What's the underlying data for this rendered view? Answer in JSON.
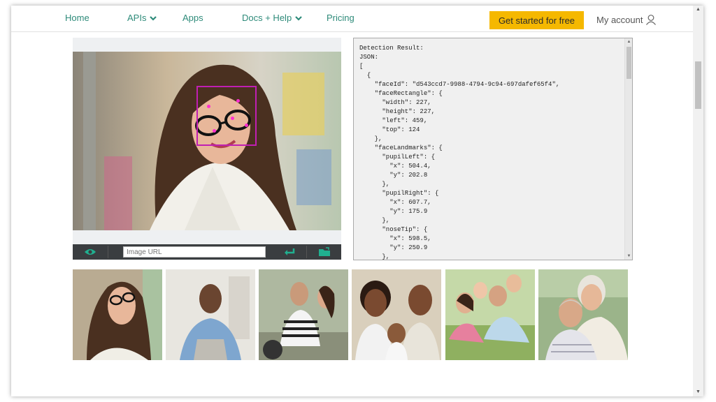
{
  "nav": {
    "home": "Home",
    "apis": "APIs",
    "apps": "Apps",
    "docs": "Docs + Help",
    "pricing": "Pricing",
    "cta": "Get started for free",
    "account": "My account"
  },
  "image_url": {
    "placeholder": "Image URL"
  },
  "json_output": "Detection Result:\nJSON:\n[\n  {\n    \"faceId\": \"d543ccd7-9988-4794-9c94-697dafef65f4\",\n    \"faceRectangle\": {\n      \"width\": 227,\n      \"height\": 227,\n      \"left\": 459,\n      \"top\": 124\n    },\n    \"faceLandmarks\": {\n      \"pupilLeft\": {\n        \"x\": 504.4,\n        \"y\": 202.8\n      },\n      \"pupilRight\": {\n        \"x\": 607.7,\n        \"y\": 175.9\n      },\n      \"noseTip\": {\n        \"x\": 598.5,\n        \"y\": 250.9\n      },",
  "colors": {
    "accent": "#2e8b7a",
    "cta": "#f5b800",
    "face_box": "#c01fb3",
    "toolbar": "#3a3d40",
    "toolbar_icon": "#20b090"
  },
  "thumbnails": [
    {
      "name": "woman-with-glasses"
    },
    {
      "name": "man-denim-shirt"
    },
    {
      "name": "couple-on-scooter"
    },
    {
      "name": "family-with-baby"
    },
    {
      "name": "family-on-grass"
    },
    {
      "name": "senior-couple"
    }
  ]
}
